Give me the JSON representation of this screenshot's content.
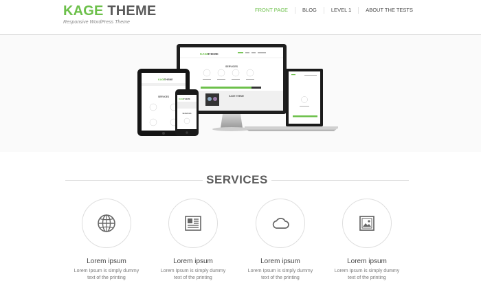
{
  "header": {
    "brand_primary": "KAGE",
    "brand_secondary": "THEME",
    "tagline": "Responsive WordPress Theme",
    "nav": [
      {
        "label": "FRONT PAGE",
        "active": true
      },
      {
        "label": "BLOG",
        "active": false
      },
      {
        "label": "LEVEL 1",
        "active": false
      },
      {
        "label": "ABOUT THE TESTS",
        "active": false
      }
    ]
  },
  "hero": {
    "devices": [
      "desktop-monitor",
      "laptop",
      "tablet",
      "smartphone"
    ],
    "mock_brand": "KAGE THEME",
    "mock_section": "SERVICES"
  },
  "services": {
    "title": "SERVICES",
    "items": [
      {
        "icon": "globe-icon",
        "title": "Lorem ipsum",
        "text": "Lorem Ipsum is simply dummy text of the printing"
      },
      {
        "icon": "newspaper-icon",
        "title": "Lorem ipsum",
        "text": "Lorem Ipsum is simply dummy text of the printing"
      },
      {
        "icon": "cloud-icon",
        "title": "Lorem ipsum",
        "text": "Lorem Ipsum is simply dummy text of the printing"
      },
      {
        "icon": "image-icon",
        "title": "Lorem ipsum",
        "text": "Lorem Ipsum is simply dummy text of the printing"
      }
    ]
  },
  "colors": {
    "accent": "#6cc04a",
    "text_dark": "#5a5a5a",
    "border": "#dedede"
  }
}
